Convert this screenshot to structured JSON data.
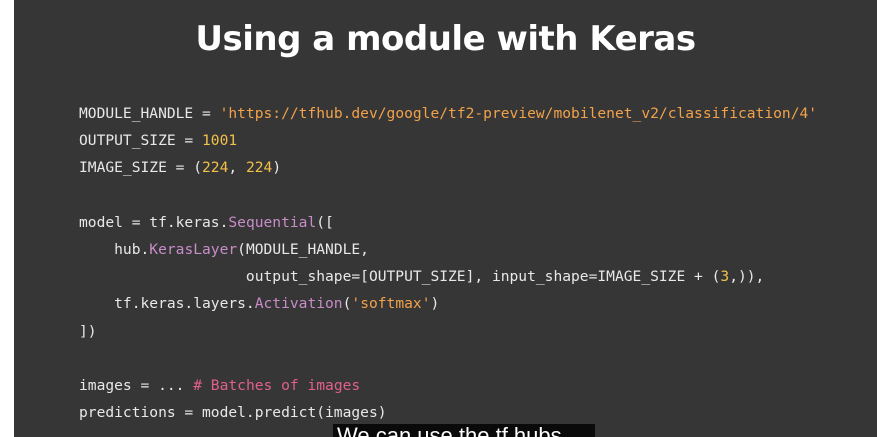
{
  "slide": {
    "title": "Using a module with Keras",
    "code": [
      [
        {
          "t": "MODULE_HANDLE = ",
          "k": "plain"
        },
        {
          "t": "'https://tfhub.dev/google/tf2-preview/mobilenet_v2/classification/4'",
          "k": "str"
        }
      ],
      [
        {
          "t": "OUTPUT_SIZE = ",
          "k": "plain"
        },
        {
          "t": "1001",
          "k": "num"
        }
      ],
      [
        {
          "t": "IMAGE_SIZE = (",
          "k": "plain"
        },
        {
          "t": "224",
          "k": "num"
        },
        {
          "t": ", ",
          "k": "plain"
        },
        {
          "t": "224",
          "k": "num"
        },
        {
          "t": ")",
          "k": "plain"
        }
      ],
      [],
      [
        {
          "t": "model = tf.keras.",
          "k": "plain"
        },
        {
          "t": "Sequential",
          "k": "cls"
        },
        {
          "t": "([",
          "k": "plain"
        }
      ],
      [
        {
          "t": "    hub.",
          "k": "plain"
        },
        {
          "t": "KerasLayer",
          "k": "cls"
        },
        {
          "t": "(MODULE_HANDLE,",
          "k": "plain"
        }
      ],
      [
        {
          "t": "                   output_shape=[OUTPUT_SIZE], input_shape=IMAGE_SIZE + (",
          "k": "plain"
        },
        {
          "t": "3",
          "k": "num"
        },
        {
          "t": ",)),",
          "k": "plain"
        }
      ],
      [
        {
          "t": "    tf.keras.layers.",
          "k": "plain"
        },
        {
          "t": "Activation",
          "k": "cls"
        },
        {
          "t": "(",
          "k": "plain"
        },
        {
          "t": "'softmax'",
          "k": "str"
        },
        {
          "t": ")",
          "k": "plain"
        }
      ],
      [
        {
          "t": "])",
          "k": "plain"
        }
      ],
      [],
      [
        {
          "t": "images = ... ",
          "k": "plain"
        },
        {
          "t": "# Batches of images",
          "k": "cmt"
        }
      ],
      [
        {
          "t": "predictions = model.predict(images)",
          "k": "plain"
        }
      ]
    ]
  },
  "caption": {
    "text": "We can use the tf.hubs"
  },
  "colors": {
    "slide_background": "#363636",
    "string": "#f2a24a",
    "number": "#f2c14a",
    "class_name": "#c88cc9",
    "comment": "#e0608c"
  }
}
